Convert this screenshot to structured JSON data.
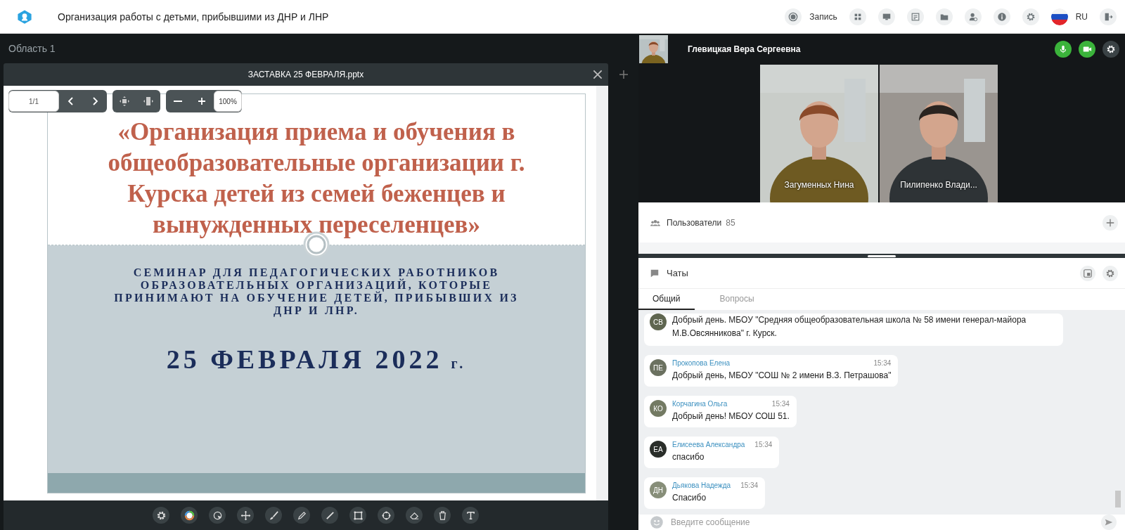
{
  "app": {
    "title": "Организация работы с детьми, прибывшими из ДНР и ЛНР",
    "record_label": "Запись",
    "language": "RU"
  },
  "area": {
    "title": "Область 1"
  },
  "presentation": {
    "file_name": "ЗАСТАВКА 25 ФЕВРАЛЯ.pptx",
    "page": "1/1",
    "zoom": "100%",
    "slide": {
      "title": "«Организация приема и обучения в общеобразовательные организации г. Курска детей из семей беженцев и вынужденных переселенцев»",
      "subtitle": "СЕМИНАР ДЛЯ ПЕДАГОГИЧЕСКИХ РАБОТНИКОВ ОБРАЗОВАТЕЛЬНЫХ ОРГАНИЗАЦИЙ, КОТОРЫЕ ПРИНИМАЮТ НА ОБУЧЕНИЕ ДЕТЕЙ, ПРИБЫВШИХ ИЗ ДНР И ЛНР.",
      "date": "25 ФЕВРАЛЯ 2022",
      "date_suffix": "г."
    }
  },
  "presenter": {
    "name": "Глевицкая Вера Сергеевна",
    "mic_on": true,
    "camera_on": true
  },
  "videos": [
    {
      "name": "Загуменных Нина"
    },
    {
      "name": "Пилипенко Влади..."
    }
  ],
  "users": {
    "label": "Пользователи",
    "count": "85"
  },
  "chats": {
    "title": "Чаты",
    "tabs": [
      {
        "label": "Общий",
        "selected": true
      },
      {
        "label": "Вопросы",
        "selected": false
      }
    ],
    "messages": [
      {
        "initials": "СВ",
        "color": "#5f6650",
        "text": "Добрый день. МБОУ \"Средняя общеобразовательная школа № 58 имени генерал-майора М.В.Овсянникова\" г. Курск."
      },
      {
        "initials": "ПЕ",
        "color": "#6b7160",
        "author": "Прокопова Елена",
        "time": "15:34",
        "text": "Добрый день, МБОУ \"СОШ № 2 имени В.З. Петрашова\""
      },
      {
        "initials": "КО",
        "color": "#737a63",
        "author": "Корчагина Ольга",
        "time": "15:34",
        "text": "Добрый день! МБОУ СОШ 51."
      },
      {
        "initials": "ЕА",
        "color": "#2a2e2a",
        "author": "Елисеева Александра",
        "time": "15:34",
        "text": "спасибо"
      },
      {
        "initials": "ДН",
        "color": "#878e79",
        "author": "Дьякова Надежда",
        "time": "15:34",
        "text": "Спасибо"
      }
    ],
    "input": {
      "placeholder": "Введите сообщение"
    }
  }
}
